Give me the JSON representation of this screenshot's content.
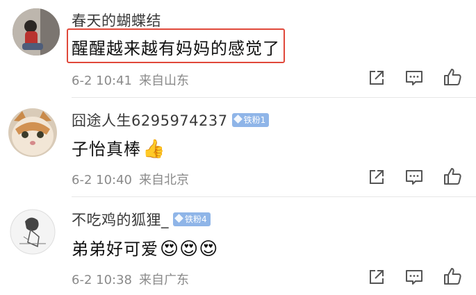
{
  "comments": [
    {
      "username": "春天的蝴蝶结",
      "badge": "",
      "content": "醒醒越来越有妈妈的感觉了",
      "emoji": "",
      "time": "6-2 10:41",
      "location": "来自山东"
    },
    {
      "username": "囧途人生6295974237",
      "badge": "铁粉1",
      "content": "子怡真棒",
      "emoji": "👍",
      "time": "6-2 10:40",
      "location": "来自北京"
    },
    {
      "username": "不吃鸡的狐狸_",
      "badge": "铁粉4",
      "content": "弟弟好可爱",
      "emoji": "😍😍😍",
      "time": "6-2 10:38",
      "location": "来自广东"
    }
  ],
  "colors": {
    "highlight_border": "#e0483a",
    "badge_bg": "#8fb5e8",
    "meta_text": "#8a8a8a"
  },
  "icons": [
    "share-icon",
    "comment-icon",
    "like-icon"
  ]
}
